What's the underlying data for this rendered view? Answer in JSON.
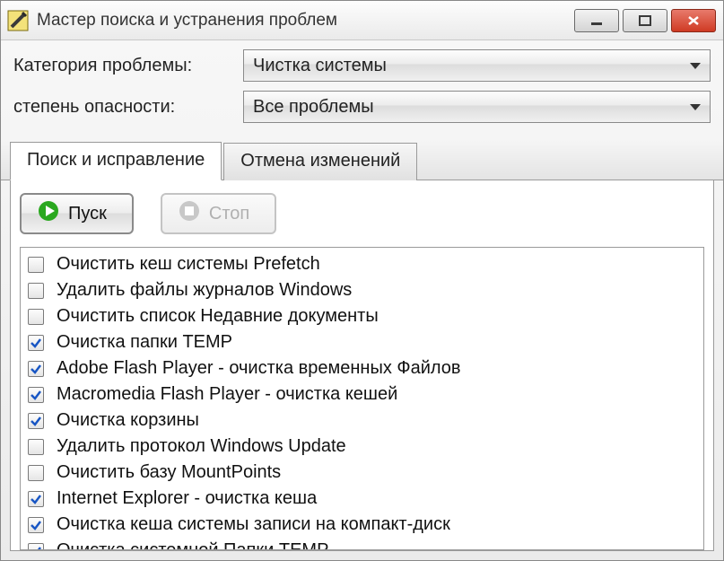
{
  "window": {
    "title": "Мастер поиска и устранения проблем"
  },
  "filters": {
    "category_label": "Категория проблемы:",
    "category_value": "Чистка системы",
    "severity_label": "степень опасности:",
    "severity_value": "Все проблемы"
  },
  "tabs": {
    "active": "Поиск и исправление",
    "other": "Отмена изменений"
  },
  "toolbar": {
    "start": "Пуск",
    "stop": "Стоп"
  },
  "items": [
    {
      "label": "Очистить кеш системы Prefetch",
      "checked": false
    },
    {
      "label": "Удалить файлы журналов Windows",
      "checked": false
    },
    {
      "label": "Очистить список Недавние документы",
      "checked": false
    },
    {
      "label": "Очистка папки TEMP",
      "checked": true
    },
    {
      "label": "Adobe Flash Player - очистка временных Файлов",
      "checked": true
    },
    {
      "label": "Macromedia Flash Player - очистка кешей",
      "checked": true
    },
    {
      "label": "Очистка корзины",
      "checked": true
    },
    {
      "label": "Удалить протокол Windows Update",
      "checked": false
    },
    {
      "label": "Очистить базу MountPoints",
      "checked": false
    },
    {
      "label": "Internet Explorer - очистка кеша",
      "checked": true
    },
    {
      "label": "Очистка кеша системы записи на компакт-диск",
      "checked": true
    },
    {
      "label": "Очистка системной Папки TEMP",
      "checked": true
    }
  ]
}
